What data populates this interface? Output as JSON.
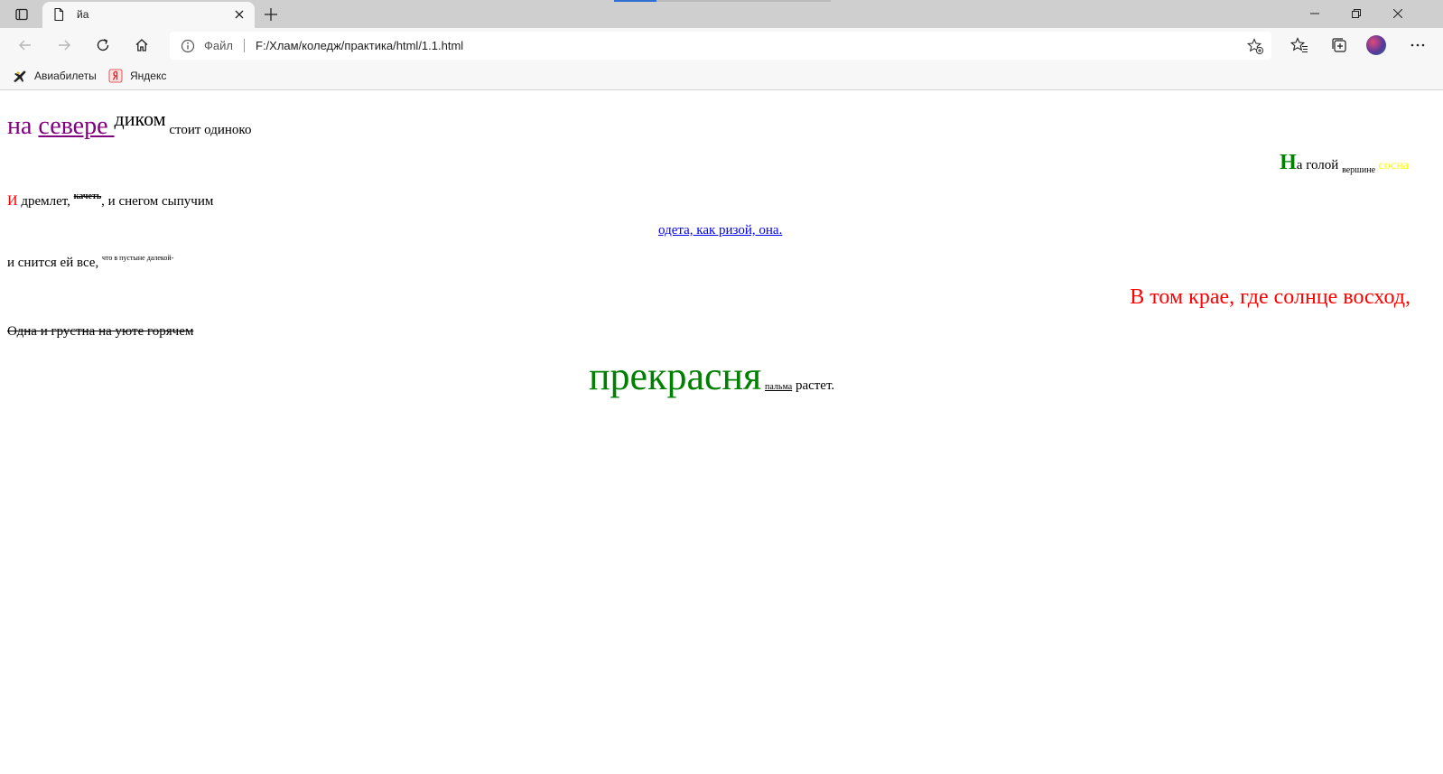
{
  "browser": {
    "tab_title": "йа",
    "address": {
      "file_label": "Файл",
      "url": "F:/Хлам/коледж/практика/html/1.1.html"
    },
    "bookmarks": [
      {
        "label": "Авиабилеты",
        "icon": "airplane-icon"
      },
      {
        "label": "Яндекс",
        "icon": "yandex-icon"
      }
    ],
    "colors": {
      "accent": "#2f6fd1",
      "frame": "#cfcfcf",
      "toolbar": "#f7f7f7"
    }
  },
  "page": {
    "line1": {
      "a": "на ",
      "b": "севере ",
      "c": "диком",
      "d": " стоит одиноко"
    },
    "line2": {
      "a": "Н",
      "b": "а голой ",
      "c": "вершине",
      "d": " сосна"
    },
    "line3": {
      "a": "И",
      "b": " дремлет, ",
      "c": "качеть",
      "d": ", и снегом сыпучим"
    },
    "line4": "одета, как ризой, она.",
    "line5": {
      "a": "и снится ей все, ",
      "b": "что в пустыне далекой-"
    },
    "line6": "В том крае, где солнце восход,",
    "line7": "Одна и грустна на уюте горячем",
    "line8": {
      "a": "прекрасня",
      "b": " ",
      "c": "пальма",
      "d": " растет."
    },
    "colors": {
      "purple": "#800080",
      "red": "#ff0000",
      "green": "#008000",
      "yellow": "#ffff00",
      "link": "#0000ee"
    }
  }
}
